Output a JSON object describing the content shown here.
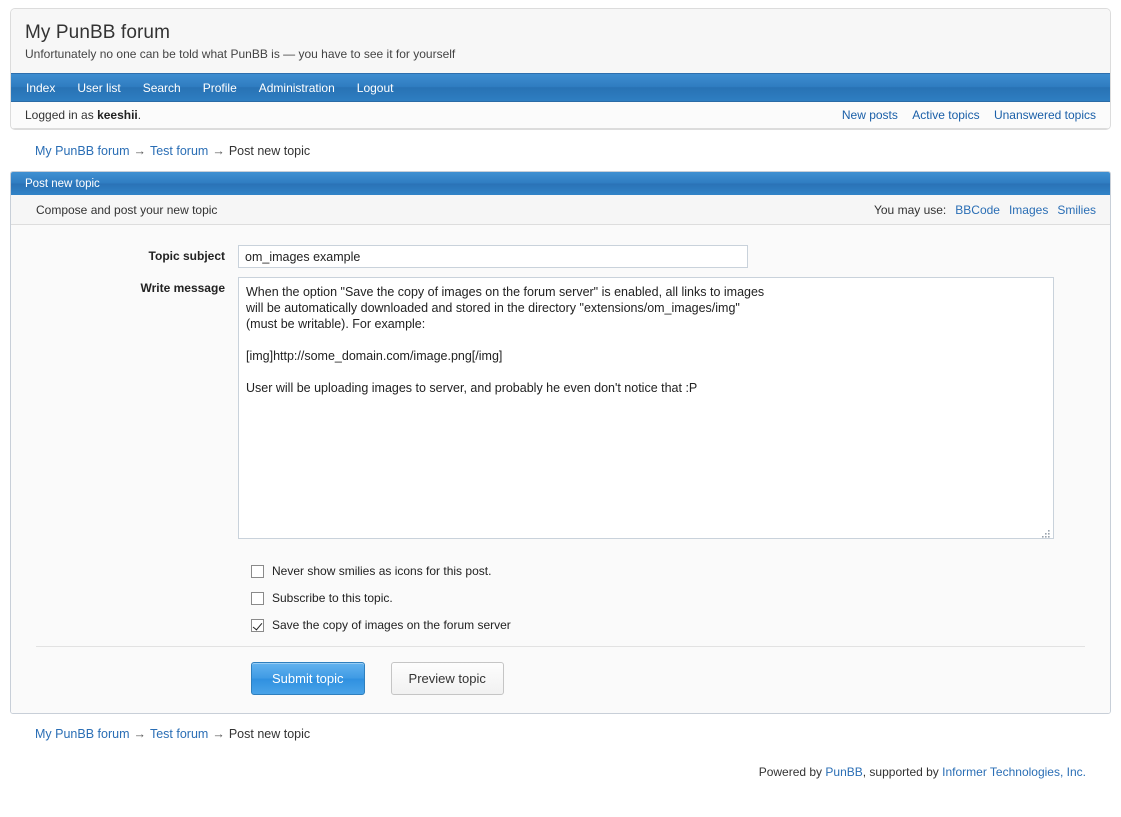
{
  "forum": {
    "title": "My PunBB forum",
    "description": "Unfortunately no one can be told what PunBB is — you have to see it for yourself"
  },
  "nav": {
    "items": [
      {
        "label": "Index"
      },
      {
        "label": "User list"
      },
      {
        "label": "Search"
      },
      {
        "label": "Profile"
      },
      {
        "label": "Administration"
      },
      {
        "label": "Logout"
      }
    ]
  },
  "status": {
    "logged_in_prefix": "Logged in as ",
    "username": "keeshii",
    "logged_in_suffix": ".",
    "links": [
      {
        "label": "New posts"
      },
      {
        "label": "Active topics"
      },
      {
        "label": "Unanswered topics"
      }
    ]
  },
  "breadcrumb": {
    "root": "My PunBB forum",
    "forum": "Test forum",
    "current": "Post new topic",
    "separator": "→"
  },
  "panel": {
    "header": "Post new topic",
    "subtitle": "Compose and post your new topic",
    "may_use_label": "You may use:",
    "may_use_links": [
      {
        "label": "BBCode"
      },
      {
        "label": "Images"
      },
      {
        "label": "Smilies"
      }
    ]
  },
  "form": {
    "subject_label": "Topic subject",
    "subject_value": "om_images example",
    "subject_placeholder": "",
    "message_label": "Write message",
    "message_value": "When the option \"Save the copy of images on the forum server\" is enabled, all links to images\nwill be automatically downloaded and stored in the directory \"extensions/om_images/img\"\n(must be writable). For example:\n\n[img]http://some_domain.com/image.png[/img]\n\nUser will be uploading images to server, and probably he even don't notice that :P",
    "message_placeholder": "",
    "checkboxes": [
      {
        "label": "Never show smilies as icons for this post.",
        "checked": false
      },
      {
        "label": "Subscribe to this topic.",
        "checked": false
      },
      {
        "label": "Save the copy of images on the forum server",
        "checked": true
      }
    ],
    "submit_label": "Submit topic",
    "preview_label": "Preview topic"
  },
  "footer": {
    "powered_prefix": "Powered by ",
    "powered_link": "PunBB",
    "supported_mid": ", supported by ",
    "supported_link": "Informer Technologies, Inc."
  },
  "colors": {
    "accent_blue": "#2f7cc0",
    "link_blue": "#2a6eb5",
    "panel_bg": "#fafafa",
    "primary_button": "#3e9ae4"
  }
}
